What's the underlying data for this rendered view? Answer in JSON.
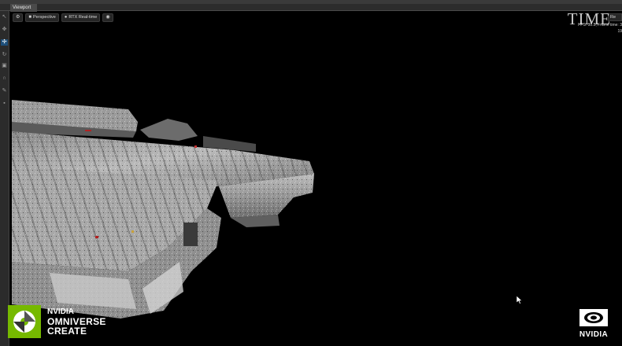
{
  "viewport_tab": {
    "label": "Viewport"
  },
  "viewport_toolbar": {
    "settings_icon": "gear-icon",
    "camera": {
      "label": "Perspective",
      "icon": "camera-icon"
    },
    "renderer": {
      "label": "RTX Real-time",
      "icon": "lightbulb-icon"
    },
    "visibility_icon": "eye-icon"
  },
  "render_settings": {
    "label": "Re"
  },
  "stats": {
    "line1": "FPS: 30.5, Frame time: 3",
    "line2": "19"
  },
  "watermark": {
    "text": "TIME"
  },
  "branding": {
    "omniverse_line1": "NVIDIA",
    "omniverse_line2": "OMNIVERSE",
    "omniverse_line3": "CREATE",
    "nvidia_text": "NVIDIA",
    "accent_color": "#76b900"
  }
}
